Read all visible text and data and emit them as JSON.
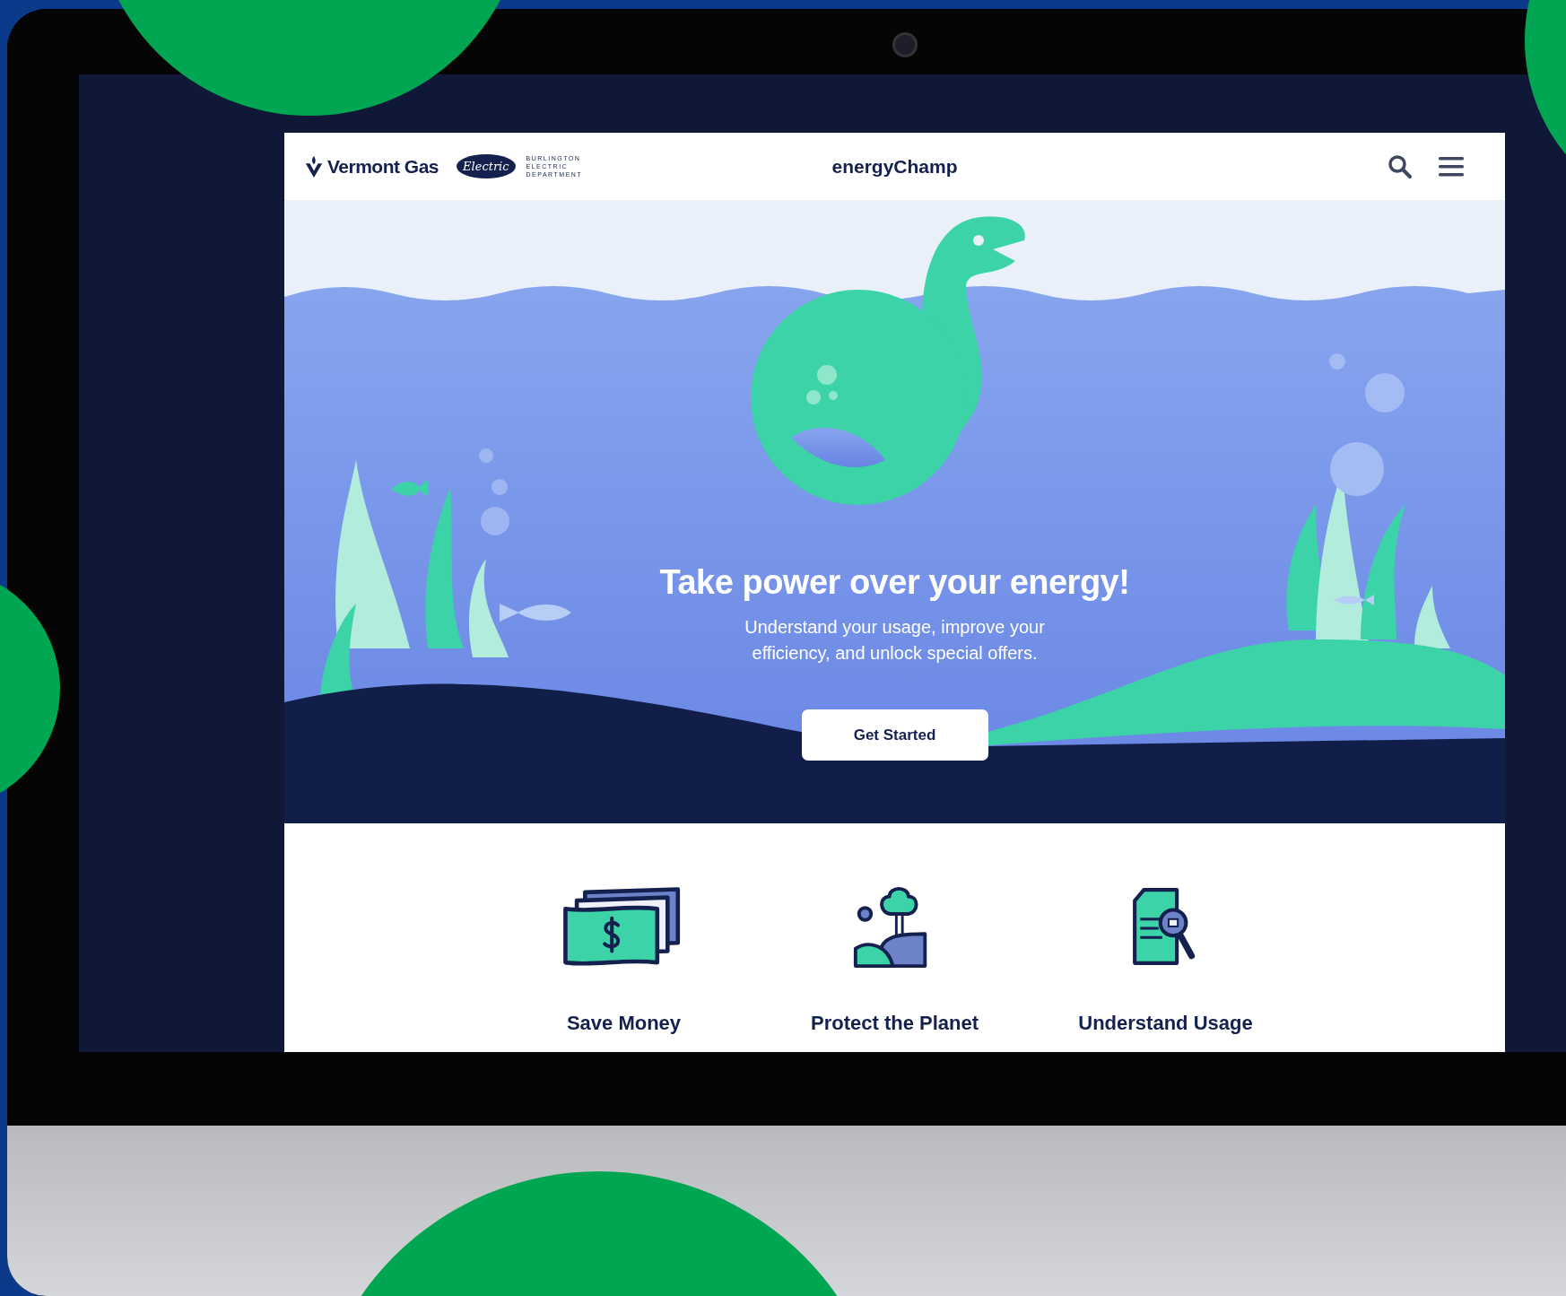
{
  "header": {
    "brands": [
      {
        "kind": "gas",
        "name": "Vermont Gas"
      },
      {
        "kind": "electric",
        "badge": "Electric",
        "lines": [
          "BURLINGTON",
          "ELECTRIC",
          "DEPARTMENT"
        ]
      }
    ],
    "title": "energyChamp"
  },
  "hero": {
    "heading": "Take power over your energy!",
    "subheading": "Understand your usage, improve your efficiency, and unlock special offers.",
    "button": "Get Started"
  },
  "features": [
    {
      "kind": "money",
      "label": "Save Money"
    },
    {
      "kind": "planet",
      "label": "Protect the Planet"
    },
    {
      "kind": "usage",
      "label": "Understand Usage"
    }
  ]
}
